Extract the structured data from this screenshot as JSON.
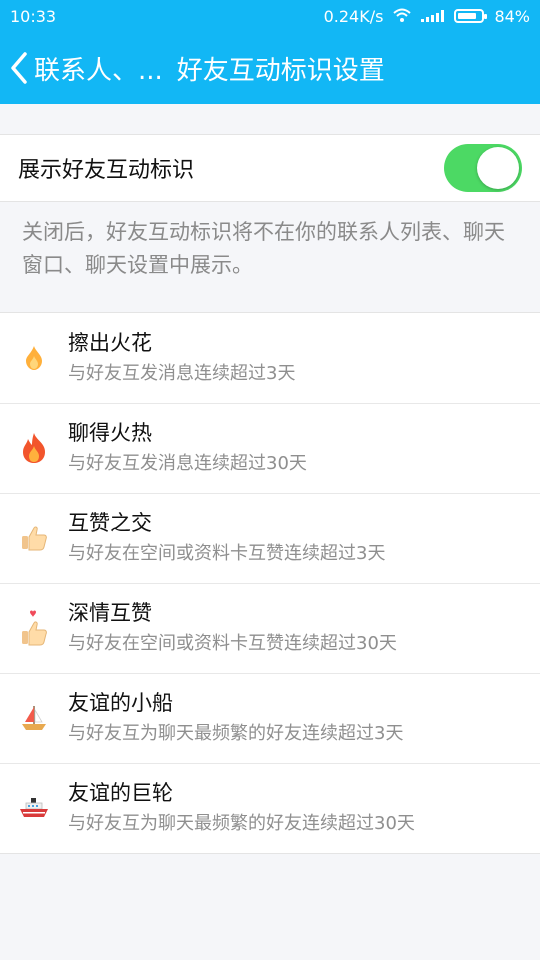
{
  "status": {
    "time": "10:33",
    "speed": "0.24K/s",
    "battery": "84%",
    "battery_level": 0.84
  },
  "nav": {
    "back_label": "联系人、...",
    "title": "好友互动标识设置"
  },
  "toggle": {
    "label": "展示好友互动标识",
    "on": true
  },
  "description": "关闭后，好友互动标识将不在你的联系人列表、聊天窗口、聊天设置中展示。",
  "items": [
    {
      "icon": "small-flame-icon",
      "title": "擦出火花",
      "subtitle": "与好友互发消息连续超过3天"
    },
    {
      "icon": "big-flame-icon",
      "title": "聊得火热",
      "subtitle": "与好友互发消息连续超过30天"
    },
    {
      "icon": "thumbs-up-icon",
      "title": "互赞之交",
      "subtitle": "与好友在空间或资料卡互赞连续超过3天"
    },
    {
      "icon": "thumbs-up-heart-icon",
      "title": "深情互赞",
      "subtitle": "与好友在空间或资料卡互赞连续超过30天"
    },
    {
      "icon": "sailboat-icon",
      "title": "友谊的小船",
      "subtitle": "与好友互为聊天最频繁的好友连续超过3天"
    },
    {
      "icon": "ship-icon",
      "title": "友谊的巨轮",
      "subtitle": "与好友互为聊天最频繁的好友连续超过30天"
    }
  ],
  "colors": {
    "header": "#12b7f5",
    "toggle_on": "#4cd964"
  }
}
